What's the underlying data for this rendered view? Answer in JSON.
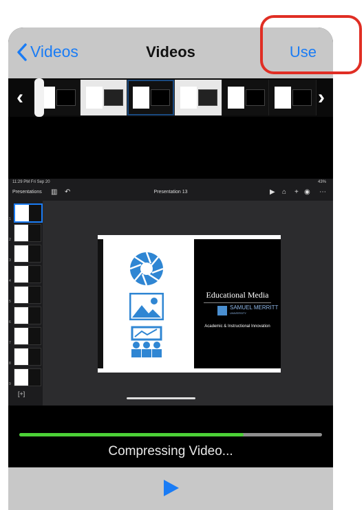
{
  "nav": {
    "back_label": "Videos",
    "title": "Videos",
    "use_label": "Use"
  },
  "ipad": {
    "status_time": "11:29 PM  Fri Sep 20",
    "status_battery": "43%",
    "presentations_label": "Presentations",
    "doc_title": "Presentation 13",
    "slide_numbers": [
      "1",
      "2",
      "3",
      "4",
      "5",
      "6",
      "7",
      "8",
      "9"
    ]
  },
  "slide": {
    "title": "Educational Media",
    "logo_name": "SAMUEL MERRITT",
    "logo_sub": "UNIVERSITY",
    "subtitle": "Academic & Instructional Innovation"
  },
  "progress": {
    "fraction": 0.74,
    "status": "Compressing Video...",
    "color": "#4cd137"
  },
  "colors": {
    "accent": "#1a7cf5",
    "annotation": "#e02e24"
  },
  "icons": {
    "back": "chevron-left-icon",
    "play": "play-icon",
    "prev": "chevron-left-icon",
    "next": "chevron-right-icon"
  }
}
